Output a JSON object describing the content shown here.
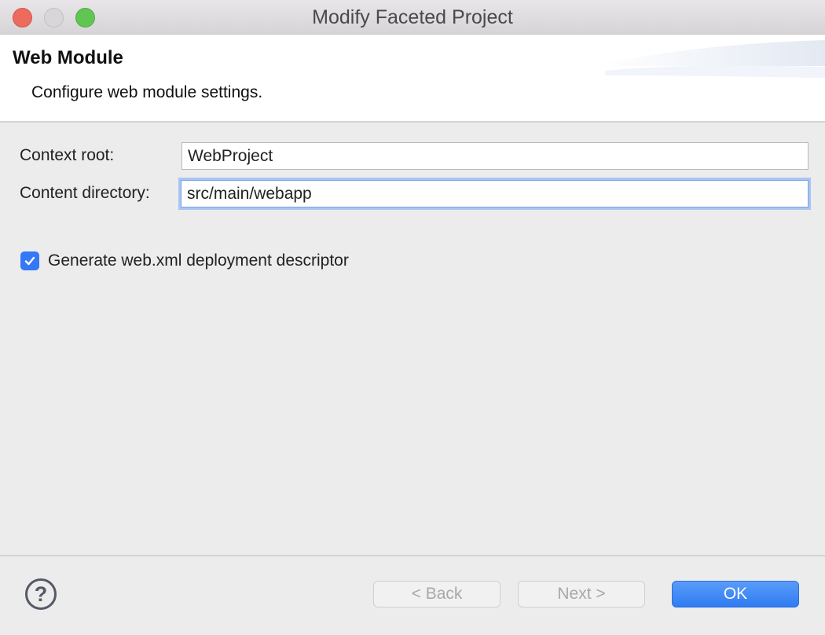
{
  "window": {
    "title": "Modify Faceted Project"
  },
  "header": {
    "title": "Web Module",
    "description": "Configure web module settings."
  },
  "form": {
    "context_root_label": "Context root:",
    "context_root_value": "WebProject",
    "content_directory_label": "Content directory:",
    "content_directory_value": "src/main/webapp",
    "generate_webxml_label": "Generate web.xml deployment descriptor",
    "generate_webxml_checked": true
  },
  "footer": {
    "help_symbol": "?",
    "back_label": "< Back",
    "next_label": "Next >",
    "ok_label": "OK"
  },
  "colors": {
    "accent": "#3478f6",
    "focus_ring": "#a9c5f2",
    "close": "#ed6a5e",
    "zoom": "#61c554"
  }
}
